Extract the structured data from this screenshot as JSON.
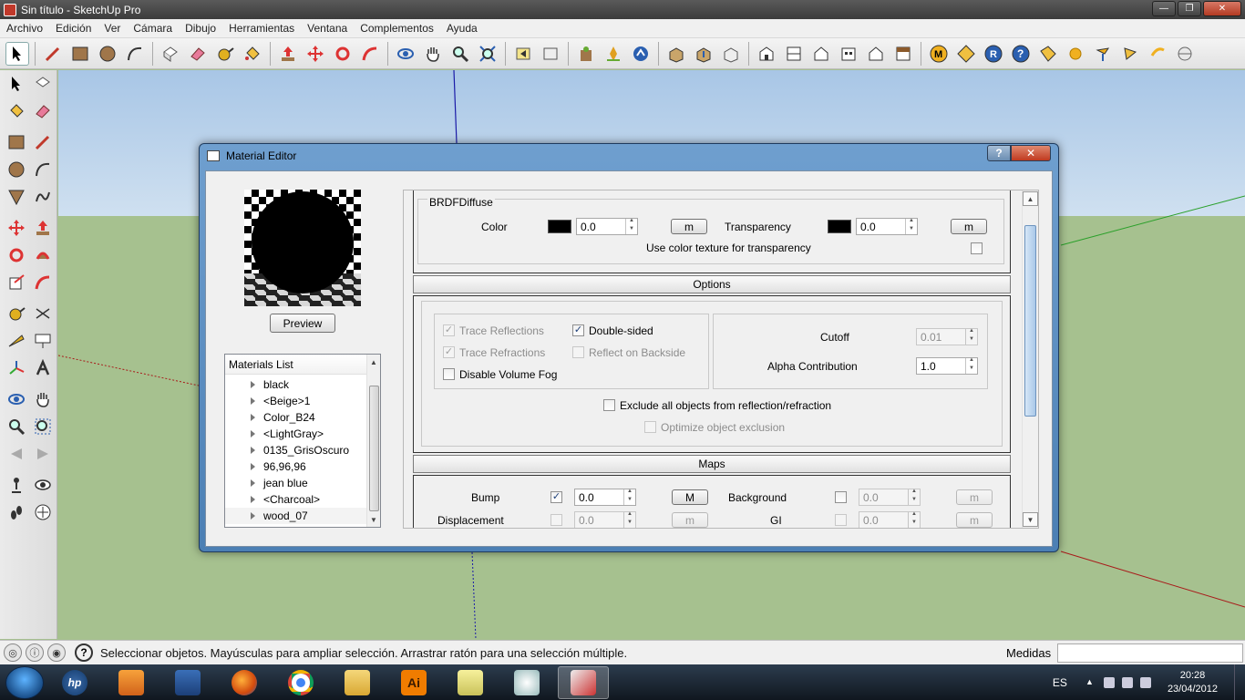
{
  "window": {
    "title": "Sin título - SketchUp Pro"
  },
  "menu": [
    "Archivo",
    "Edición",
    "Ver",
    "Cámara",
    "Dibujo",
    "Herramientas",
    "Ventana",
    "Complementos",
    "Ayuda"
  ],
  "toolbar_icons": [
    "select-icon",
    "pencil-icon",
    "rectangle-icon",
    "circle-icon",
    "arc-icon",
    "make-component-icon",
    "eraser-icon",
    "tape-measure-icon",
    "paint-bucket-icon",
    "push-pull-icon",
    "move-icon",
    "rotate-icon",
    "follow-me-icon",
    "orbit-icon",
    "pan-icon",
    "zoom-icon",
    "zoom-extents-icon",
    "previous-view-icon",
    "next-view-icon",
    "warehouse-icon",
    "extension-icon",
    "share-model-icon",
    "get-models-icon",
    "share-component-icon",
    "components-icon",
    "iso-view-icon",
    "top-view-icon",
    "front-view-icon",
    "right-view-icon",
    "back-view-icon",
    "left-view-icon",
    "vray-material-icon",
    "vray-options-icon",
    "vray-render-icon",
    "vray-help-icon",
    "vray-frame-buffer-icon",
    "omni-light-icon",
    "spot-light-icon",
    "rect-light-icon",
    "sphere-light-icon",
    "vray-sphere-icon"
  ],
  "dialog": {
    "title": "Material Editor",
    "help_label": "?",
    "close_label": "✕",
    "preview_button": "Preview",
    "materials_list": {
      "header": "Materials List",
      "items": [
        "black",
        "<Beige>1",
        "Color_B24",
        "<LightGray>",
        "0135_GrisOscuro",
        "96,96,96",
        "jean blue",
        "<Charcoal>",
        "wood_07"
      ]
    },
    "brdf": {
      "title": "BRDFDiffuse",
      "color_label": "Color",
      "color_value": "0.0",
      "color_map": "m",
      "transparency_label": "Transparency",
      "transparency_value": "0.0",
      "transparency_map": "m",
      "use_color_texture": "Use color texture for transparency",
      "swatch_color": "#000000"
    },
    "options": {
      "header": "Options",
      "trace_reflections": "Trace Reflections",
      "trace_refractions": "Trace Refractions",
      "disable_volume_fog": "Disable Volume Fog",
      "double_sided": "Double-sided",
      "reflect_on_backside": "Reflect on Backside",
      "cutoff_label": "Cutoff",
      "cutoff_value": "0.01",
      "alpha_label": "Alpha Contribution",
      "alpha_value": "1.0",
      "exclude_all": "Exclude all objects from reflection/refraction",
      "optimize_exclusion": "Optimize object exclusion",
      "check_mark": "✓"
    },
    "maps": {
      "header": "Maps",
      "bump_label": "Bump",
      "bump_value": "0.0",
      "bump_map": "M",
      "background_label": "Background",
      "background_value": "0.0",
      "background_map": "m",
      "displacement_label": "Displacement",
      "displacement_value": "0.0",
      "displacement_map": "m",
      "gi_label": "GI",
      "gi_value": "0.0",
      "gi_map": "m"
    }
  },
  "status": {
    "message": "Seleccionar objetos. Mayúsculas para ampliar selección. Arrastrar ratón para una selección múltiple.",
    "measures_label": "Medidas",
    "help_glyph": "?"
  },
  "taskbar": {
    "language": "ES",
    "time": "20:28",
    "date": "23/04/2012",
    "hp_label": "hp",
    "illustrator_label": "Ai",
    "apps": [
      "hp-icon",
      "media-player-icon",
      "stocks-icon",
      "firefox-icon",
      "chrome-icon",
      "explorer-icon",
      "illustrator-icon",
      "notes-icon",
      "paint-icon",
      "sketchup-icon"
    ]
  },
  "colors": {
    "sky": "#cfe0f0",
    "ground": "#a6c18f",
    "dialog_frame": "#4b7fb4",
    "accent": "#1d3f78"
  }
}
